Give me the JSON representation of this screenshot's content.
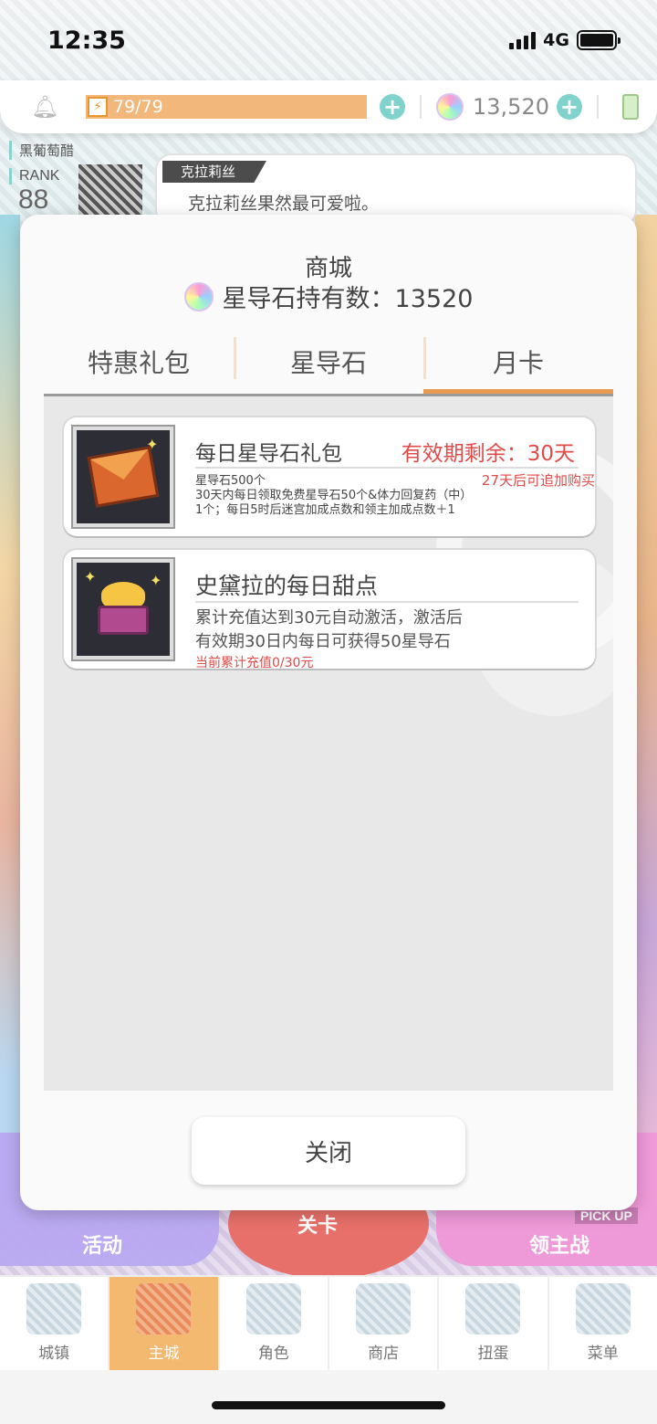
{
  "status_bar": {
    "time": "12:35",
    "network": "4G"
  },
  "resources": {
    "stamina": "79/79",
    "gems": "13,520"
  },
  "player": {
    "name": "黑葡萄醋",
    "rank_label": "RANK",
    "rank_value": "88"
  },
  "dialog": {
    "speaker": "克拉莉丝",
    "text": "克拉莉丝果然最可爱啦。"
  },
  "background_buttons": {
    "left": "活动",
    "mid": "关卡",
    "right": "领主战",
    "pickup": "PICK UP"
  },
  "shop": {
    "title": "商城",
    "gem_line": "星导石持有数：13520",
    "tabs": [
      {
        "label": "特惠礼包",
        "active": false
      },
      {
        "label": "星导石",
        "active": false
      },
      {
        "label": "月卡",
        "active": true
      }
    ],
    "cards": [
      {
        "title": "每日星导石礼包",
        "remaining": "有效期剩余：30天",
        "rebuy": "27天后可追加购买",
        "desc": [
          "星导石500个",
          "30天内每日领取免费星导石50个&体力回复药（中）",
          "1个；每日5时后迷宫加成点数和领主加成点数＋1"
        ]
      },
      {
        "title": "史黛拉的每日甜点",
        "desc": [
          "累计充值达到30元自动激活，激活后",
          "有效期30日内每日可获得50星导石"
        ],
        "progress": "当前累计充值0/30元"
      }
    ],
    "close_label": "关闭"
  },
  "bottom_nav": [
    {
      "label": "城镇",
      "icon": "town-icon",
      "active": false
    },
    {
      "label": "主城",
      "icon": "main-city-icon",
      "active": true
    },
    {
      "label": "角色",
      "icon": "character-icon",
      "active": false
    },
    {
      "label": "商店",
      "icon": "store-icon",
      "active": false
    },
    {
      "label": "扭蛋",
      "icon": "gacha-icon",
      "active": false
    },
    {
      "label": "菜单",
      "icon": "menu-icon",
      "active": false
    }
  ],
  "colors": {
    "accent": "#e99a52",
    "stamina": "#f2b77a",
    "plus": "#7fd3cc",
    "warning": "#e24a4a",
    "nav_active": "#f4b970"
  }
}
